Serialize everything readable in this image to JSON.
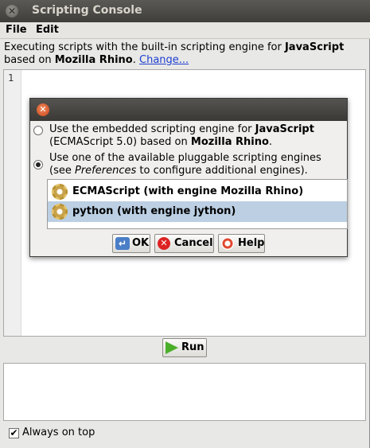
{
  "window": {
    "title": "Scripting Console"
  },
  "menu": {
    "file": "File",
    "edit": "Edit"
  },
  "info": {
    "text_prefix": "Executing scripts with the built-in scripting engine for ",
    "engine": "JavaScript",
    "text_mid": " based on ",
    "impl": "Mozilla Rhino",
    "text_suffix": ".",
    "change_link": "Change..."
  },
  "editor": {
    "line_number": "1"
  },
  "run_button": "Run",
  "always_on_top": {
    "label": "Always on top",
    "checked": true,
    "check_glyph": "✔"
  },
  "dialog": {
    "option1": {
      "prefix": "Use the embedded scripting engine for ",
      "engine": "JavaScript",
      "mid": " (ECMAScript 5.0) based on ",
      "impl": "Mozilla Rhino",
      "suffix": ".",
      "selected": false
    },
    "option2": {
      "prefix": "Use one of the available pluggable scripting engines (see ",
      "pref": "Preferences",
      "suffix": " to configure additional engines).",
      "selected": true
    },
    "engines": [
      {
        "label": "ECMAScript (with engine Mozilla Rhino)",
        "selected": false,
        "icon": "gear-icon"
      },
      {
        "label": "python (with engine jython)",
        "selected": true,
        "icon": "gear-icon"
      }
    ],
    "buttons": {
      "ok": "OK",
      "cancel": "Cancel",
      "help": "Help"
    },
    "glyphs": {
      "close": "✕",
      "ok": "↵",
      "cancel": "✕"
    }
  }
}
